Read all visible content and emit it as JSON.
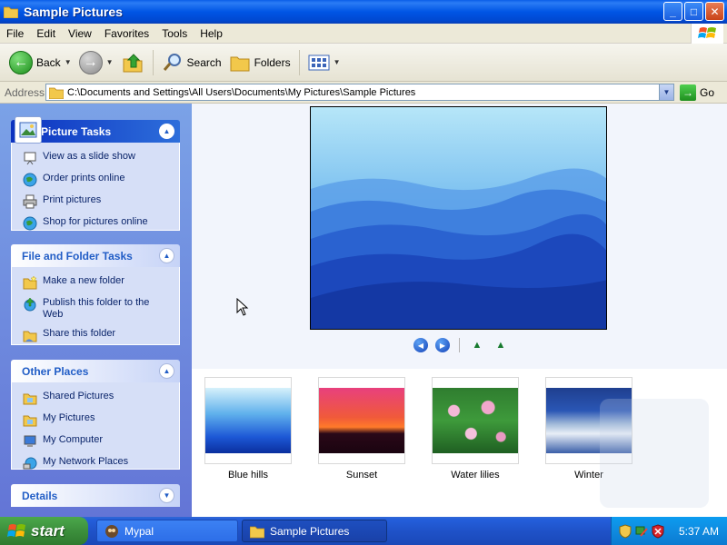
{
  "window": {
    "title": "Sample Pictures",
    "buttons": {
      "minimize": "_",
      "maximize": "□",
      "close": "✕"
    }
  },
  "menu": [
    "File",
    "Edit",
    "View",
    "Favorites",
    "Tools",
    "Help"
  ],
  "toolbar": {
    "back_label": "Back",
    "search_label": "Search",
    "folders_label": "Folders"
  },
  "address": {
    "label": "Address",
    "value": "C:\\Documents and Settings\\All Users\\Documents\\My Pictures\\Sample Pictures",
    "go_label": "Go"
  },
  "task_pane": {
    "picture_tasks": {
      "title": "Picture Tasks",
      "items": [
        {
          "label": "View as a slide show",
          "icon": "slideshow-icon"
        },
        {
          "label": "Order prints online",
          "icon": "globe-icon"
        },
        {
          "label": "Print pictures",
          "icon": "printer-icon"
        },
        {
          "label": "Shop for pictures online",
          "icon": "globe-icon"
        }
      ]
    },
    "file_folder_tasks": {
      "title": "File and Folder Tasks",
      "items": [
        {
          "label": "Make a new folder",
          "icon": "new-folder-icon"
        },
        {
          "label": "Publish this folder to the Web",
          "icon": "publish-web-icon"
        },
        {
          "label": "Share this folder",
          "icon": "share-folder-icon"
        }
      ]
    },
    "other_places": {
      "title": "Other Places",
      "items": [
        {
          "label": "Shared Pictures",
          "icon": "folder-icon"
        },
        {
          "label": "My Pictures",
          "icon": "folder-icon"
        },
        {
          "label": "My Computer",
          "icon": "computer-icon"
        },
        {
          "label": "My Network Places",
          "icon": "network-icon"
        }
      ]
    },
    "details": {
      "title": "Details"
    }
  },
  "thumbnails": [
    {
      "label": "Blue hills"
    },
    {
      "label": "Sunset"
    },
    {
      "label": "Water lilies"
    },
    {
      "label": "Winter"
    }
  ],
  "taskbar": {
    "start_label": "start",
    "tasks": [
      {
        "label": "Mypal",
        "active": false
      },
      {
        "label": "Sample Pictures",
        "active": true
      }
    ],
    "clock": "5:37 AM"
  }
}
